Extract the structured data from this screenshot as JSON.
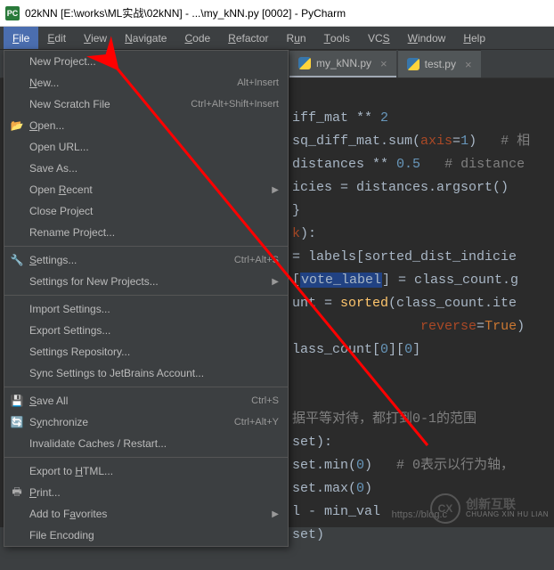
{
  "window": {
    "title": "02kNN [E:\\works\\ML实战\\02kNN] - ...\\my_kNN.py [0002] - PyCharm"
  },
  "menubar": {
    "items": [
      {
        "label": "File",
        "mn": "F"
      },
      {
        "label": "Edit",
        "mn": "E"
      },
      {
        "label": "View",
        "mn": "V"
      },
      {
        "label": "Navigate",
        "mn": "N"
      },
      {
        "label": "Code",
        "mn": "C"
      },
      {
        "label": "Refactor",
        "mn": "R"
      },
      {
        "label": "Run",
        "mn": "u"
      },
      {
        "label": "Tools",
        "mn": "T"
      },
      {
        "label": "VCS",
        "mn": "S"
      },
      {
        "label": "Window",
        "mn": "W"
      },
      {
        "label": "Help",
        "mn": "H"
      }
    ]
  },
  "filemenu": {
    "items": [
      {
        "label": "New Project..."
      },
      {
        "label": "New...",
        "mn": "N",
        "shortcut": "Alt+Insert"
      },
      {
        "label": "New Scratch File",
        "shortcut": "Ctrl+Alt+Shift+Insert"
      },
      {
        "label": "Open...",
        "mn": "O",
        "icon": "folder-open"
      },
      {
        "label": "Open URL..."
      },
      {
        "label": "Save As..."
      },
      {
        "label": "Open Recent",
        "mn": "R",
        "submenu": true
      },
      {
        "label": "Close Project"
      },
      {
        "label": "Rename Project..."
      },
      {
        "sep": true
      },
      {
        "label": "Settings...",
        "mn": "S",
        "shortcut": "Ctrl+Alt+S",
        "icon": "wrench"
      },
      {
        "label": "Settings for New Projects...",
        "submenu": true
      },
      {
        "sep": true
      },
      {
        "label": "Import Settings..."
      },
      {
        "label": "Export Settings..."
      },
      {
        "label": "Settings Repository..."
      },
      {
        "label": "Sync Settings to JetBrains Account..."
      },
      {
        "sep": true
      },
      {
        "label": "Save All",
        "mn": "S",
        "shortcut": "Ctrl+S",
        "icon": "save"
      },
      {
        "label": "Synchronize",
        "mn": "y",
        "shortcut": "Ctrl+Alt+Y",
        "icon": "sync"
      },
      {
        "label": "Invalidate Caches / Restart..."
      },
      {
        "sep": true
      },
      {
        "label": "Export to HTML...",
        "mn": "H"
      },
      {
        "label": "Print...",
        "mn": "P",
        "icon": "print"
      },
      {
        "label": "Add to Favorites",
        "mn": "a",
        "submenu": true
      },
      {
        "label": "File Encoding"
      }
    ]
  },
  "tabs": [
    {
      "name": "my_kNN.py",
      "active": true
    },
    {
      "name": "test.py",
      "active": false
    }
  ],
  "code_frag": {
    "l1a": "iff_mat",
    "l1b": " ** ",
    "l1c": "2",
    "l2a": "sq_diff_mat.sum(",
    "l2b": "axis",
    "l2c": "=",
    "l2d": "1",
    "l2e": ")   ",
    "l2f": "# 相",
    "l3a": "distances ** ",
    "l3b": "0.5",
    "l3c": "   ",
    "l3d": "# distance",
    "l4a": "icies = distances.argsort()",
    "l5a": "}",
    "l6a": "k",
    "l6b": "):",
    "l7a": "= labels[sorted_dist_indicie",
    "l8a": "[",
    "l8b": "vote_label",
    "l8c": "] = class_count.g",
    "l9a": "unt = ",
    "l9b": "sorted",
    "l9c": "(class_count.ite",
    "l10a": "reverse",
    "l10b": "=",
    "l10c": "True",
    "l10d": ")",
    "l11a": "lass_count[",
    "l11b": "0",
    "l11c": "][",
    "l11d": "0",
    "l11e": "]",
    "l12a": "据平等对待，都打到0-1的范围",
    "l13a": "set):",
    "l14a": "set.min(",
    "l14b": "0",
    "l14c": ")   ",
    "l14d": "# 0表示以行为轴，",
    "l15a": "set.max(",
    "l15b": "0",
    "l15c": ")",
    "l16a": "l - min_val",
    "l17a": "set)"
  },
  "watermark": {
    "logo_text": "CX",
    "cn": "创新互联",
    "en": "CHUANG XIN HU LIAN",
    "blog": "https://blog.c"
  }
}
